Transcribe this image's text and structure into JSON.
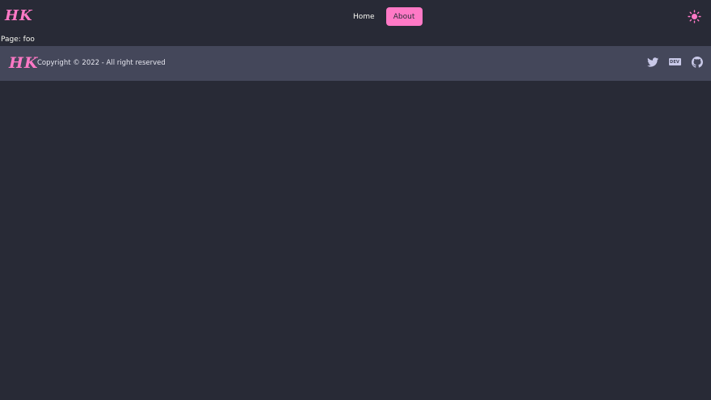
{
  "header": {
    "logo": "HK",
    "nav": [
      {
        "label": "Home",
        "active": false
      },
      {
        "label": "About",
        "active": true
      }
    ],
    "theme_toggle_icon": "sun-icon"
  },
  "main": {
    "page_text": "Page: foo"
  },
  "footer": {
    "logo": "HK",
    "copyright": "Copyright © 2022 - All right reserved",
    "social": [
      {
        "icon": "twitter-icon"
      },
      {
        "icon": "dev-icon",
        "label": "DEV"
      },
      {
        "icon": "github-icon"
      }
    ]
  },
  "colors": {
    "background": "#282a36",
    "footer_bg": "#44475a",
    "accent": "#ff79c6",
    "text": "#f8f8f2",
    "icon": "#c9c9e8"
  }
}
